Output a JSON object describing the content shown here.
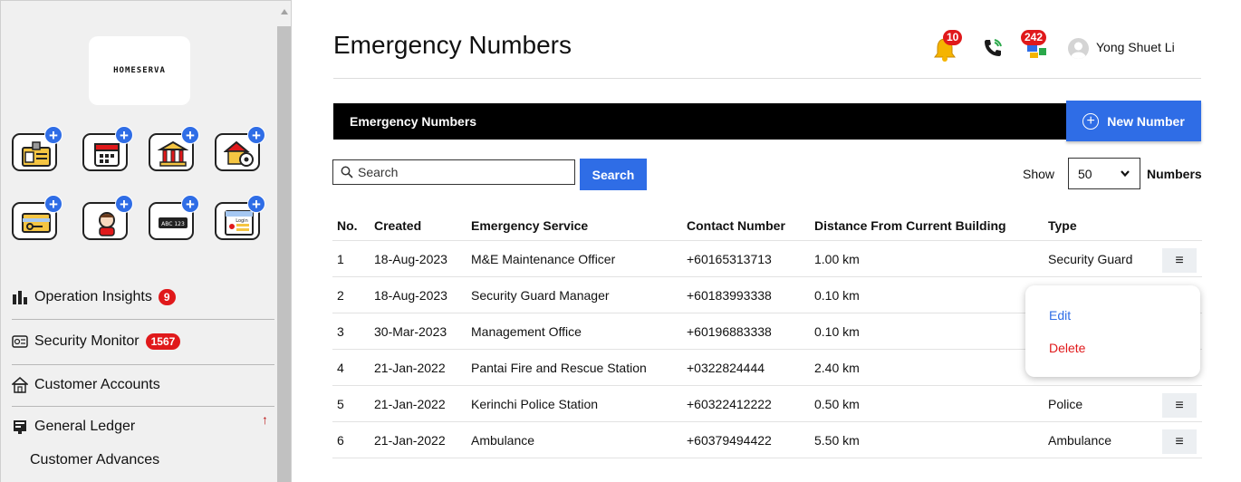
{
  "sidebar": {
    "logo_text": "HOMESERVA",
    "app_icons": [
      "id-card-icon",
      "calendar-icon",
      "bank-icon",
      "building-services-icon",
      "key-card-icon",
      "resident-icon",
      "plate-number-icon",
      "login-screen-icon"
    ],
    "plate_text": "ABC 123",
    "login_text": "Login",
    "nav": [
      {
        "label": "Operation Insights",
        "badge": "9",
        "icon": "bar-chart-icon"
      },
      {
        "label": "Security Monitor",
        "badge": "1567",
        "icon": "cctv-icon"
      },
      {
        "label": "Customer Accounts",
        "badge": "",
        "icon": "home-icon"
      },
      {
        "label": "General Ledger",
        "badge": "",
        "icon": "ledger-icon"
      }
    ],
    "expand_arrow": "↑",
    "sub_item": "Customer Advances"
  },
  "header": {
    "title": "Emergency Numbers",
    "notif_count": "10",
    "msg_count": "242",
    "user_name": "Yong Shuet Li"
  },
  "toolbar": {
    "bar_title": "Emergency Numbers",
    "new_label": "New Number"
  },
  "search": {
    "placeholder": "Search",
    "button_label": "Search",
    "show_label": "Show",
    "show_value": "50",
    "numbers_label": "Numbers"
  },
  "table": {
    "columns": [
      "No.",
      "Created",
      "Emergency Service",
      "Contact Number",
      "Distance From Current Building",
      "Type"
    ],
    "rows": [
      [
        "1",
        "18-Aug-2023",
        "M&E Maintenance Officer",
        "+60165313713",
        "1.00 km",
        "Security Guard"
      ],
      [
        "2",
        "18-Aug-2023",
        "Security Guard Manager",
        "+60183993338",
        "0.10 km",
        ""
      ],
      [
        "3",
        "30-Mar-2023",
        "Management Office",
        "+60196883338",
        "0.10 km",
        ""
      ],
      [
        "4",
        "21-Jan-2022",
        "Pantai Fire and Rescue Station",
        "+0322824444",
        "2.40 km",
        ""
      ],
      [
        "5",
        "21-Jan-2022",
        "Kerinchi Police Station",
        "+60322412222",
        "0.50 km",
        "Police"
      ],
      [
        "6",
        "21-Jan-2022",
        "Ambulance",
        "+60379494422",
        "5.50 km",
        "Ambulance"
      ]
    ],
    "menu_glyph": "≡"
  },
  "dropdown": {
    "edit_label": "Edit",
    "delete_label": "Delete"
  },
  "colors": {
    "accent": "#2f6de6",
    "danger": "#e0191b",
    "bar": "#000000"
  }
}
